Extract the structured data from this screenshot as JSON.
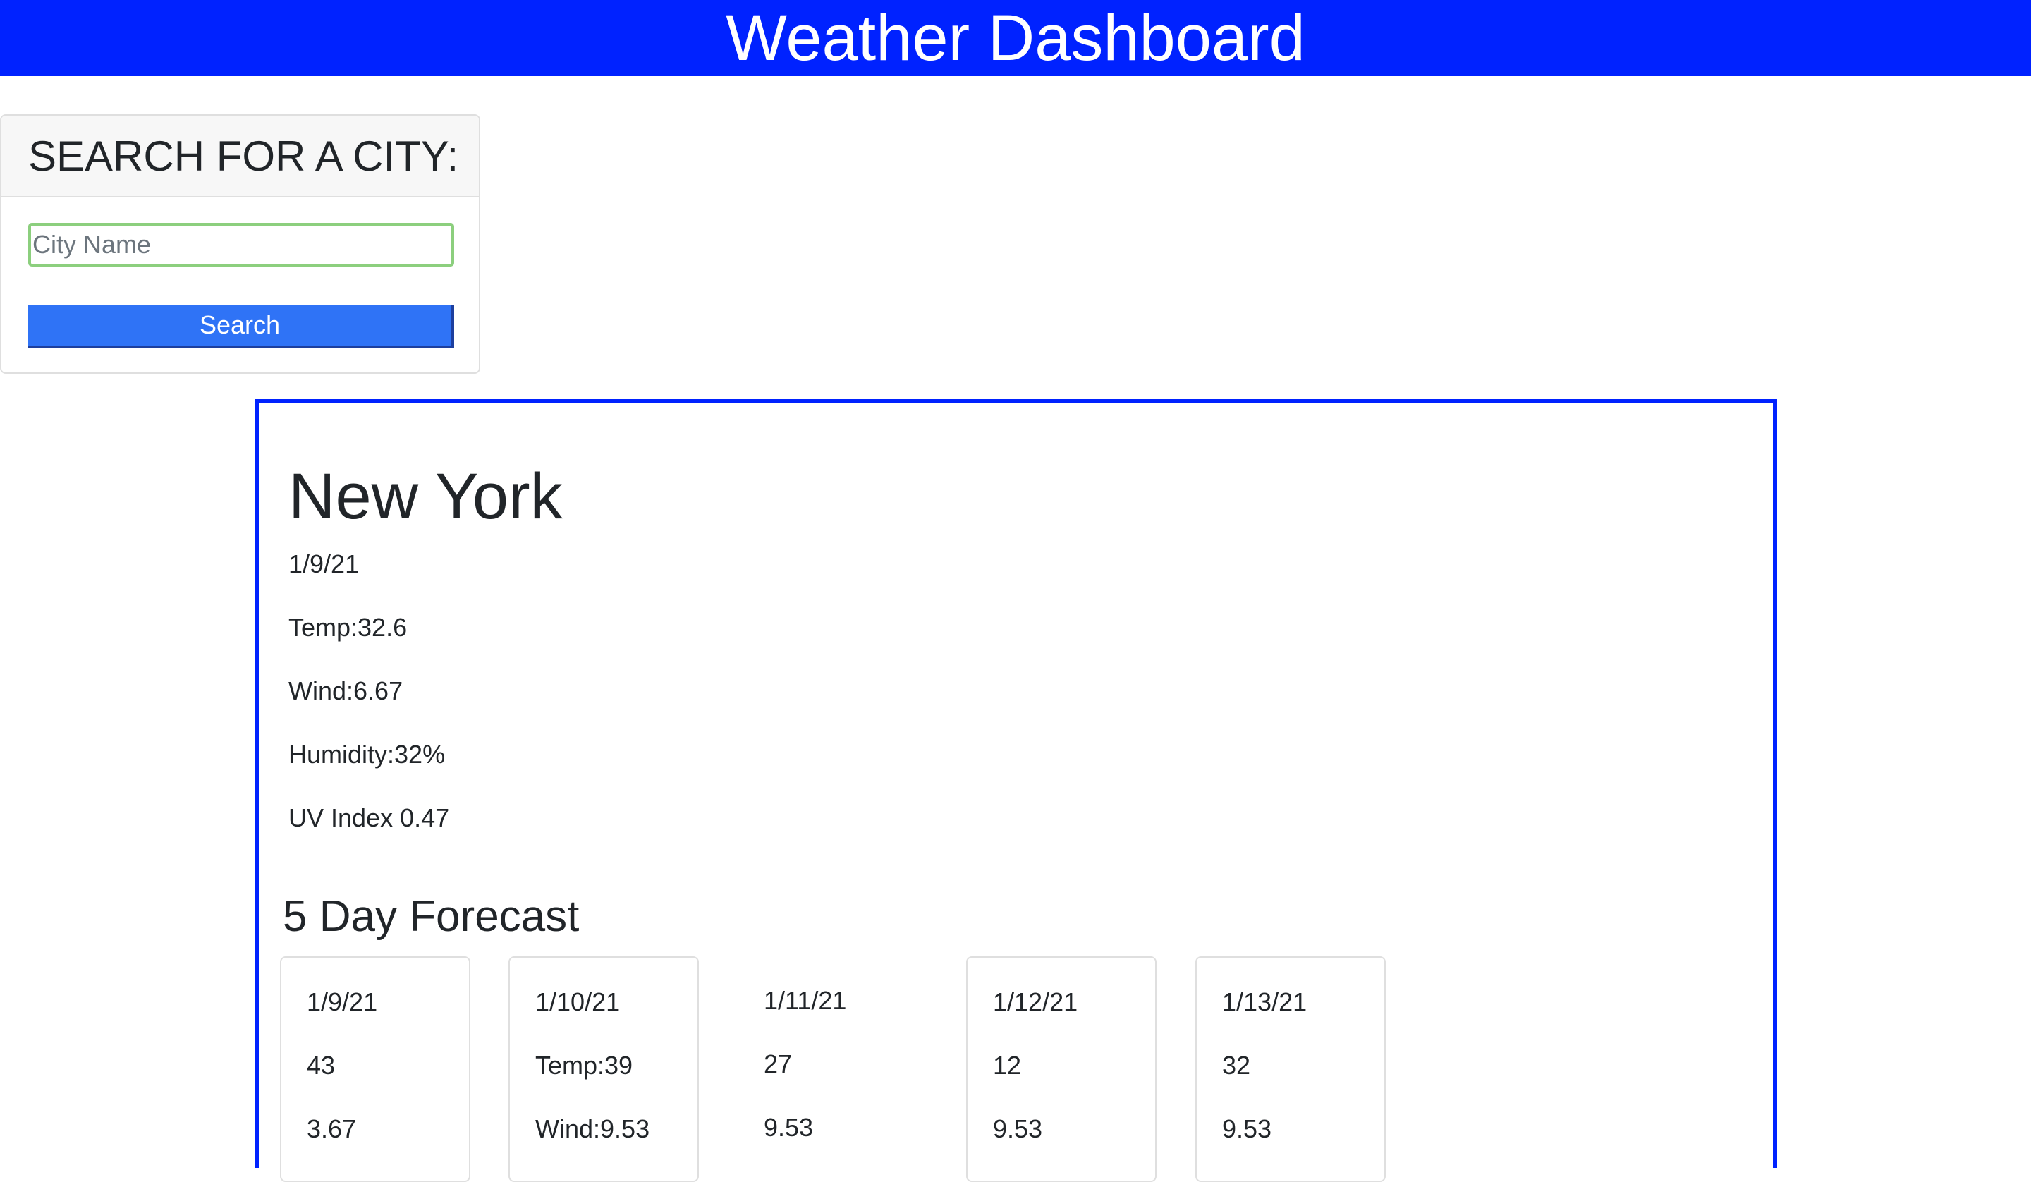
{
  "header": {
    "title": "Weather Dashboard"
  },
  "search": {
    "heading": "SEARCH FOR A CITY:",
    "placeholder": "City Name",
    "value": "",
    "button_label": "Search"
  },
  "current": {
    "city": "New York",
    "date": "1/9/21",
    "temp": "Temp:32.6",
    "wind": "Wind:6.67",
    "humidity": "Humidity:32%",
    "uv": "UV Index 0.47"
  },
  "forecast": {
    "title": "5 Day Forecast",
    "days": [
      {
        "date": "1/9/21",
        "temp": "43",
        "wind": "3.67"
      },
      {
        "date": "1/10/21",
        "temp": "Temp:39",
        "wind": "Wind:9.53"
      },
      {
        "date": "1/11/21",
        "temp": "27",
        "wind": "9.53"
      },
      {
        "date": "1/12/21",
        "temp": "12",
        "wind": "9.53"
      },
      {
        "date": "1/13/21",
        "temp": "32",
        "wind": "9.53"
      }
    ]
  },
  "colors": {
    "header_bg": "#0022ff",
    "panel_border": "#0022ff",
    "button_bg": "#2f73f6",
    "input_border": "#8ccf7e"
  }
}
